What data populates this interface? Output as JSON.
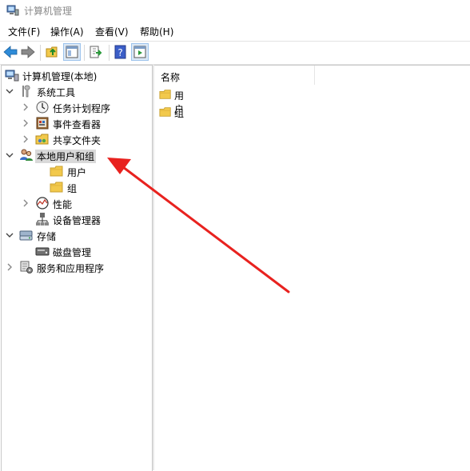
{
  "window": {
    "title": "计算机管理"
  },
  "menu": [
    {
      "label": "文件(F)"
    },
    {
      "label": "操作(A)"
    },
    {
      "label": "查看(V)"
    },
    {
      "label": "帮助(H)"
    }
  ],
  "toolbar": {
    "buttons": [
      "back-icon",
      "forward-icon",
      "up-folder-icon",
      "show-hide-tree-icon",
      "export-list-icon",
      "help-icon",
      "show-action-pane-icon"
    ]
  },
  "tree": {
    "root": "计算机管理(本地)",
    "system_tools": "系统工具",
    "task_scheduler": "任务计划程序",
    "event_viewer": "事件查看器",
    "shared_folders": "共享文件夹",
    "local_users_groups": "本地用户和组",
    "users": "用户",
    "groups": "组",
    "performance": "性能",
    "device_manager": "设备管理器",
    "storage": "存储",
    "disk_management": "磁盘管理",
    "services_apps": "服务和应用程序"
  },
  "list": {
    "columns": [
      "名称"
    ],
    "items": [
      "用户",
      "组"
    ]
  },
  "colors": {
    "annotation_arrow": "#e8221f",
    "folder": "#f2c94c",
    "selection": "#d9d9d9"
  }
}
